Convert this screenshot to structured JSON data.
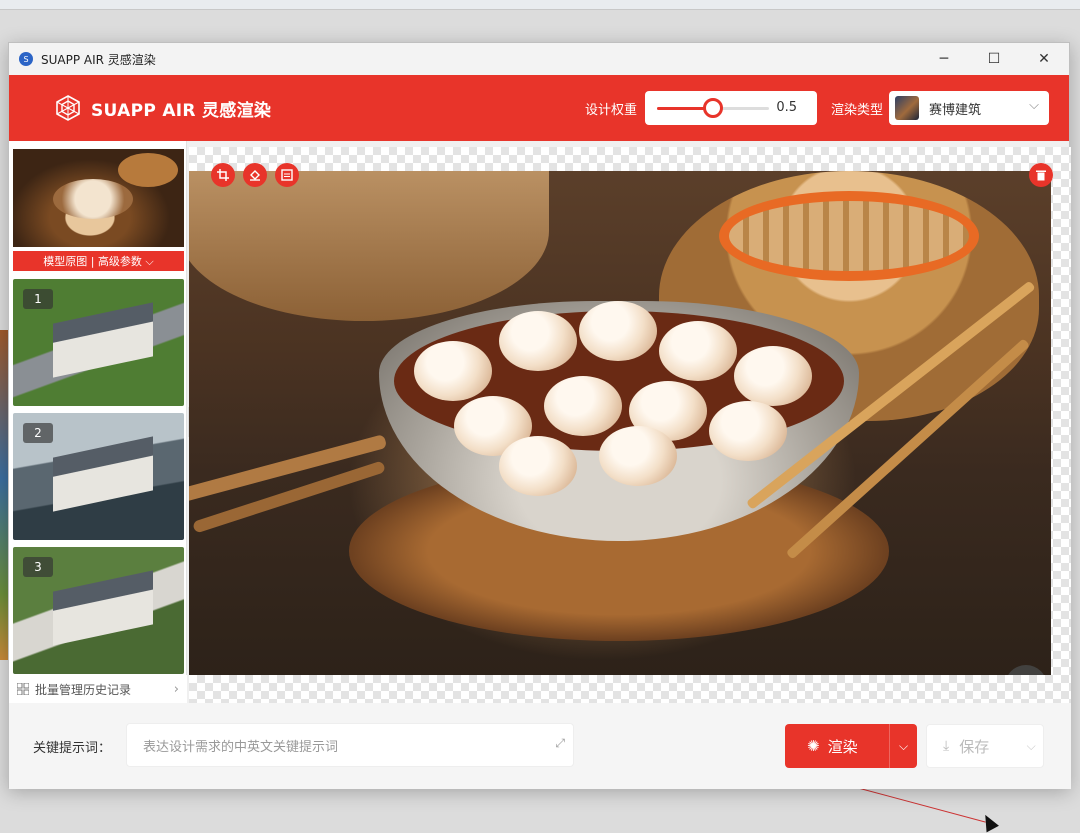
{
  "window": {
    "title": "SUAPP AIR 灵感渲染",
    "controls": {
      "minimize": "─",
      "maximize": "☐",
      "close": "✕"
    }
  },
  "header": {
    "brand_name": "SUAPP AIR 灵感渲染",
    "weight_label": "设计权重",
    "weight_value": "0.5",
    "weight_fraction": 0.5,
    "render_type_label": "渲染类型",
    "render_type_value": "赛博建筑",
    "accent_color": "#e8342a"
  },
  "sidebar": {
    "original_bar_label": "模型原图 | 高级参数 ⌵",
    "history_items": [
      {
        "number": "1"
      },
      {
        "number": "2"
      },
      {
        "number": "3"
      }
    ],
    "history_link_label": "批量管理历史记录",
    "history_chevron": "›"
  },
  "toolbar": {
    "crop_icon": "crop-icon",
    "brush_icon": "paint-bucket-icon",
    "image_icon": "image-frame-icon",
    "delete_icon": "trash-icon",
    "chat_icon": "chat-bubble-icon"
  },
  "bottom": {
    "keyword_label": "关键提示词：",
    "keyword_placeholder": "表达设计需求的中英文关键提示词",
    "expand_icon": "⤢",
    "render_label": "渲染",
    "render_chevron": "⌵",
    "save_label": "保存",
    "save_chevron": "⌵"
  }
}
